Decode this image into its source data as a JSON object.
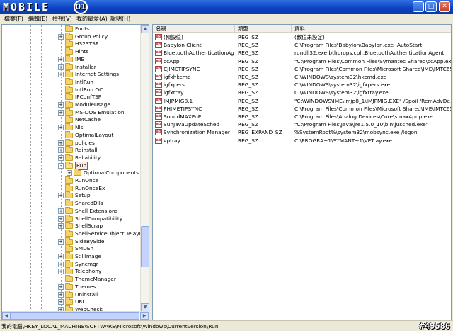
{
  "window": {
    "logo_text": "MOBILE",
    "logo_badge": "01",
    "min": "_",
    "max": "□",
    "close": "✕"
  },
  "menu": [
    "檔案(F)",
    "編輯(E)",
    "檢視(V)",
    "我的最愛(A)",
    "說明(H)"
  ],
  "tree": {
    "items": [
      {
        "label": "Fonts",
        "expander": ""
      },
      {
        "label": "Group Policy",
        "expander": "+"
      },
      {
        "label": "H323TSP",
        "expander": ""
      },
      {
        "label": "Hints",
        "expander": ""
      },
      {
        "label": "IME",
        "expander": "+"
      },
      {
        "label": "Installer",
        "expander": "+"
      },
      {
        "label": "Internet Settings",
        "expander": "+"
      },
      {
        "label": "IntlRun",
        "expander": ""
      },
      {
        "label": "IntlRun.OC",
        "expander": ""
      },
      {
        "label": "IPConfTSP",
        "expander": ""
      },
      {
        "label": "ModuleUsage",
        "expander": "+"
      },
      {
        "label": "MS-DOS Emulation",
        "expander": "+"
      },
      {
        "label": "NetCache",
        "expander": ""
      },
      {
        "label": "Nls",
        "expander": "+"
      },
      {
        "label": "OptimalLayout",
        "expander": ""
      },
      {
        "label": "policies",
        "expander": "+"
      },
      {
        "label": "Reinstall",
        "expander": "+"
      },
      {
        "label": "Reliability",
        "expander": "+"
      },
      {
        "label": "Run",
        "expander": "-",
        "selected": true
      },
      {
        "label": "OptionalComponents",
        "expander": "+",
        "child": true
      },
      {
        "label": "RunOnce",
        "expander": ""
      },
      {
        "label": "RunOnceEx",
        "expander": ""
      },
      {
        "label": "Setup",
        "expander": "+"
      },
      {
        "label": "SharedDlls",
        "expander": ""
      },
      {
        "label": "Shell Extensions",
        "expander": "+"
      },
      {
        "label": "ShellCompatibility",
        "expander": "+"
      },
      {
        "label": "ShellScrap",
        "expander": "+"
      },
      {
        "label": "ShellServiceObjectDelayLoad",
        "expander": ""
      },
      {
        "label": "SideBySide",
        "expander": "+"
      },
      {
        "label": "SMDEn",
        "expander": ""
      },
      {
        "label": "StillImage",
        "expander": "+"
      },
      {
        "label": "Syncmgr",
        "expander": "+"
      },
      {
        "label": "Telephony",
        "expander": "+"
      },
      {
        "label": "ThemeManager",
        "expander": ""
      },
      {
        "label": "Themes",
        "expander": "+"
      },
      {
        "label": "Uninstall",
        "expander": "+"
      },
      {
        "label": "URL",
        "expander": "+"
      },
      {
        "label": "WebCheck",
        "expander": "+"
      }
    ]
  },
  "list": {
    "columns": [
      "名稱",
      "類型",
      "資料"
    ],
    "rows": [
      {
        "name": "(預設值)",
        "type": "REG_SZ",
        "data": "(數值未設定)"
      },
      {
        "name": "Babylon Client",
        "type": "REG_SZ",
        "data": "C:\\Program Files\\Babylon\\Babylon.exe -AutoStart"
      },
      {
        "name": "BluetoothAuthenticationAgent",
        "type": "REG_SZ",
        "data": "rundll32.exe bthprops.cpl,,BluetoothAuthenticationAgent"
      },
      {
        "name": "ccApp",
        "type": "REG_SZ",
        "data": "\"C:\\Program Files\\Common Files\\Symantec Shared\\ccApp.exe\""
      },
      {
        "name": "CJIMETIPSYNC",
        "type": "REG_SZ",
        "data": "C:\\Program Files\\Common Files\\Microsoft Shared\\IME\\IMTC65..."
      },
      {
        "name": "igfxhkcmd",
        "type": "REG_SZ",
        "data": "C:\\WINDOWS\\system32\\hkcmd.exe"
      },
      {
        "name": "igfxpers",
        "type": "REG_SZ",
        "data": "C:\\WINDOWS\\system32\\igfxpers.exe"
      },
      {
        "name": "igfxtray",
        "type": "REG_SZ",
        "data": "C:\\WINDOWS\\system32\\igfxtray.exe"
      },
      {
        "name": "IMJPMIG8.1",
        "type": "REG_SZ",
        "data": "\"C:\\WINDOWS\\IME\\imjp8_1\\IMJPMIG.EXE\" /Spoil /RemAdvDe..."
      },
      {
        "name": "PHIMETIPSYNC",
        "type": "REG_SZ",
        "data": "C:\\Program Files\\Common Files\\Microsoft Shared\\IME\\IMTC65..."
      },
      {
        "name": "SoundMAXPnP",
        "type": "REG_SZ",
        "data": "C:\\Program Files\\Analog Devices\\Core\\smax4pnp.exe"
      },
      {
        "name": "SunJavaUpdateSched",
        "type": "REG_SZ",
        "data": "\"C:\\Program Files\\Java\\jre1.5.0_10\\bin\\jusched.exe\""
      },
      {
        "name": "Synchronization Manager",
        "type": "REG_EXPAND_SZ",
        "data": "%SystemRoot%\\system32\\mobsync.exe /logon"
      },
      {
        "name": "vptray",
        "type": "REG_SZ",
        "data": "C:\\PROGRA~1\\SYMANT~1\\VPTray.exe"
      }
    ]
  },
  "status": {
    "path": "我的電腦\\HKEY_LOCAL_MACHINE\\SOFTWARE\\Microsoft\\Windows\\CurrentVersion\\Run",
    "watermark": "#49586"
  },
  "icons": {
    "value_icon": "ab"
  }
}
